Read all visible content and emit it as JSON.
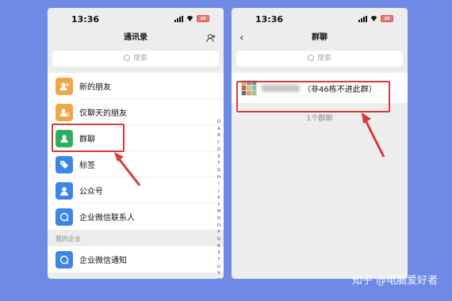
{
  "left_phone": {
    "time": "13:36",
    "battery": "20",
    "title": "通讯录",
    "search_placeholder": "搜索",
    "items": [
      {
        "label": "新的朋友",
        "icon": "new-friend-icon",
        "color": "#f0a645"
      },
      {
        "label": "仅聊天的朋友",
        "icon": "chat-only-friend-icon",
        "color": "#f0a645"
      },
      {
        "label": "群聊",
        "icon": "group-chat-icon",
        "color": "#2bb15d"
      },
      {
        "label": "标签",
        "icon": "tag-icon",
        "color": "#3d86e6"
      },
      {
        "label": "公众号",
        "icon": "official-account-icon",
        "color": "#3d86e6"
      },
      {
        "label": "企业微信联系人",
        "icon": "work-contact-icon",
        "color": "#3d86e6"
      }
    ],
    "section_label": "我的企业",
    "work_items": [
      {
        "label": "企业微信通知",
        "icon": "work-notify-icon",
        "color": "#3d86e6"
      }
    ],
    "alphabet": [
      "Q",
      "A",
      "B",
      "C",
      "D",
      "E",
      "F",
      "G",
      "H",
      "I",
      "J",
      "K",
      "L",
      "M",
      "N",
      "O",
      "P",
      "Q",
      "R",
      "S",
      "T",
      "U",
      "V",
      "W",
      "X",
      "Y",
      "Z",
      "#"
    ]
  },
  "right_phone": {
    "time": "13:36",
    "battery": "20",
    "title": "群聊",
    "search_placeholder": "搜索",
    "group": {
      "name_suffix": "（非46栋不进此群）"
    },
    "count_text": "1个群聊"
  },
  "watermark": "知乎 @电脑爱好者",
  "colors": {
    "background": "#6f8ae6",
    "highlight": "#d63a3a"
  }
}
